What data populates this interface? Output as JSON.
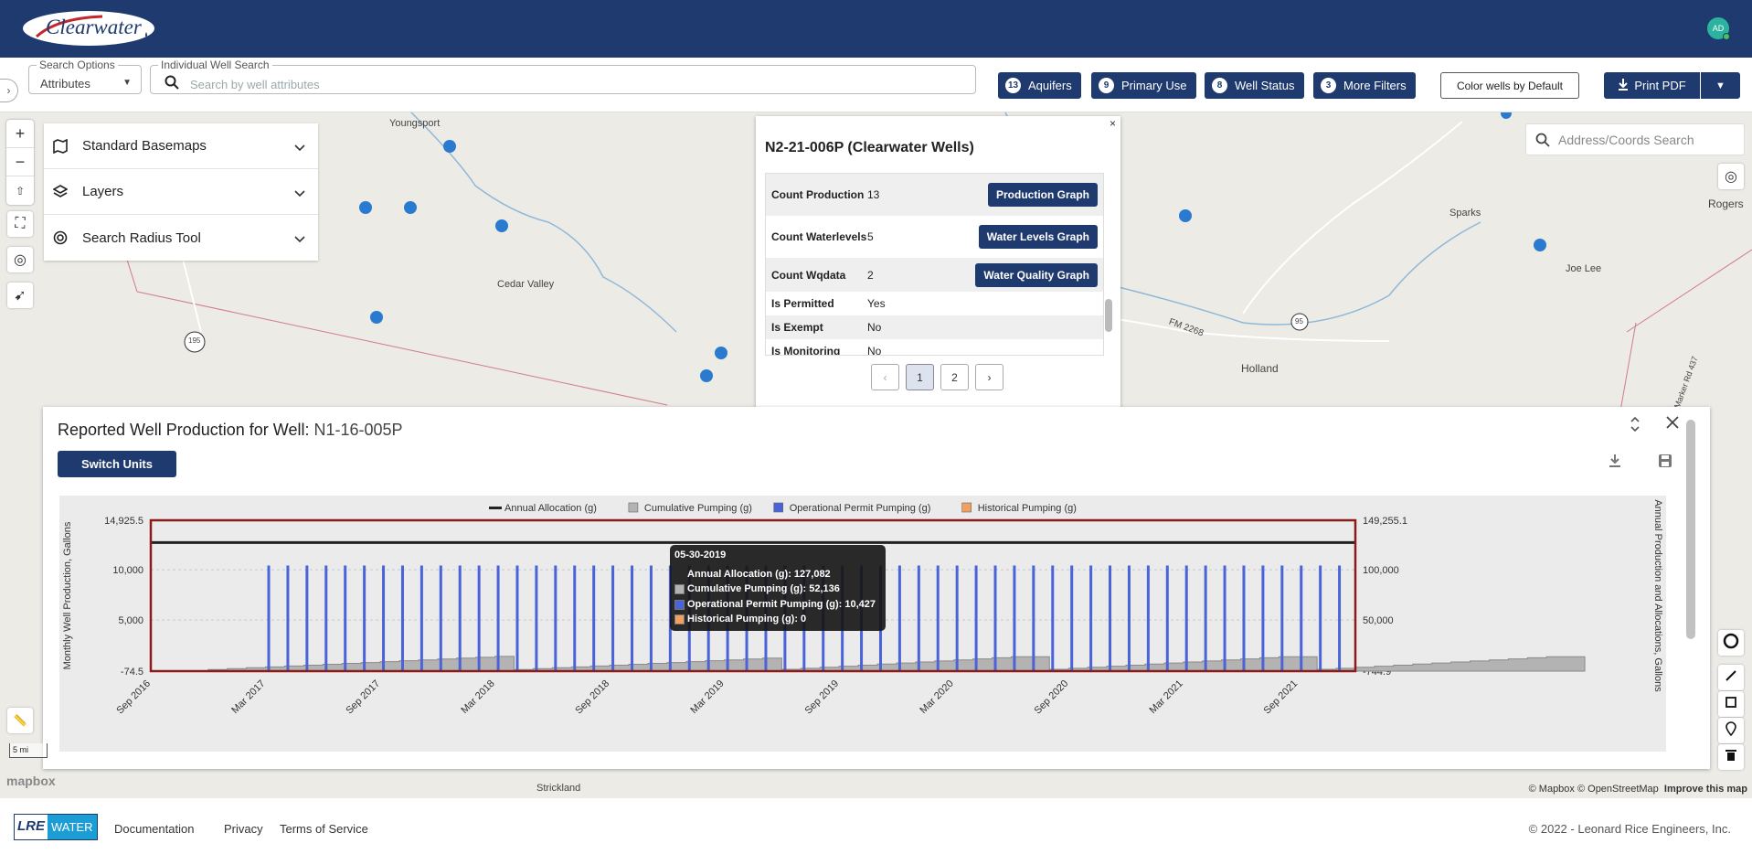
{
  "header": {
    "brand": "Clearwater",
    "avatar_initials": "AD",
    "bg_color": "#1f3a6e"
  },
  "toolbar": {
    "search_options_label": "Search Options",
    "search_options_value": "Attributes",
    "well_search_label": "Individual Well Search",
    "well_search_placeholder": "Search by well attributes",
    "filters": [
      {
        "count": "13",
        "label": "Aquifers"
      },
      {
        "count": "9",
        "label": "Primary Use"
      },
      {
        "count": "8",
        "label": "Well Status"
      },
      {
        "count": "3",
        "label": "More Filters"
      }
    ],
    "color_by": "Color wells by Default",
    "print_label": "Print PDF"
  },
  "map": {
    "layer_panel": [
      "Standard Basemaps",
      "Layers",
      "Search Radius Tool"
    ],
    "address_placeholder": "Address/Coords Search",
    "labels": {
      "youngsport": "Youngsport",
      "cedar_valley": "Cedar Valley",
      "sparks": "Sparks",
      "rogers": "Rogers",
      "joe_lee": "Joe Lee",
      "fm2268": "FM 2268",
      "holland": "Holland",
      "strickland": "Strickland",
      "r195": "195",
      "r95": "95",
      "rd437": "Marker Rd 437"
    },
    "scale": "5 mi",
    "mapbox_logo": "mapbox",
    "attribution": "© Mapbox © OpenStreetMap",
    "improve": "Improve this map",
    "well_color": "#2a7ad0"
  },
  "popup": {
    "title": "N2-21-006P (Clearwater Wells)",
    "rows": [
      {
        "key": "Count Production",
        "value": "13",
        "button": "Production Graph"
      },
      {
        "key": "Count Waterlevels",
        "value": "5",
        "button": "Water Levels Graph"
      },
      {
        "key": "Count Wqdata",
        "value": "2",
        "button": "Water Quality Graph"
      },
      {
        "key": "Is Permitted",
        "value": "Yes",
        "button": ""
      },
      {
        "key": "Is Exempt",
        "value": "No",
        "button": ""
      },
      {
        "key": "Is Monitoring",
        "value": "No",
        "button": ""
      }
    ],
    "pages": [
      "1",
      "2"
    ],
    "current_page": "1"
  },
  "chart_panel": {
    "title_prefix": "Reported Well Production for Well:",
    "well_id": "N1-16-005P",
    "switch_units": "Switch Units"
  },
  "chart_data": {
    "type": "bar",
    "legend": [
      {
        "name": "Annual Allocation (g)",
        "color": "#222222"
      },
      {
        "name": "Cumulative Pumping (g)",
        "color": "#b3b3b3"
      },
      {
        "name": "Operational Permit Pumping (g)",
        "color": "#4a63d8"
      },
      {
        "name": "Historical Pumping (g)",
        "color": "#f0a060"
      }
    ],
    "ylabel_left": "Monthly Well Production, Gallons",
    "ylabel_right": "Annual Production and Allocations, Gallons",
    "left_ticks": [
      "14,925.5",
      "10,000",
      "5,000",
      "-74.5"
    ],
    "right_ticks": [
      "149,255.1",
      "100,000",
      "50,000",
      "-744.9"
    ],
    "ylim_left": [
      -74.5,
      14925.5
    ],
    "ylim_right": [
      -744.9,
      149255.1
    ],
    "x_ticks": [
      "Sep 2016",
      "Mar 2017",
      "Sep 2017",
      "Mar 2018",
      "Sep 2018",
      "Mar 2019",
      "Sep 2019",
      "Mar 2020",
      "Sep 2020",
      "Mar 2021",
      "Sep 2021"
    ],
    "annual_allocation": 127082,
    "operational_monthly": 10427,
    "cumulative_years": [
      {
        "start": "2016-12",
        "monthly": [
          870,
          1740,
          2610,
          3480,
          4350,
          5220,
          6090,
          6960,
          7830,
          8700,
          9570,
          10440,
          11310,
          12180,
          13050,
          13920
        ]
      },
      {
        "start": "2018-04",
        "monthly": [
          870,
          1740,
          2610,
          3480,
          4350,
          5220,
          6090,
          6960,
          7830,
          8700,
          9570,
          10440,
          11310,
          12180
        ]
      },
      {
        "start": "2019-06",
        "monthly": [
          1043,
          2085,
          3128,
          4171,
          5214,
          6256,
          7299,
          8342,
          9384,
          10427,
          11470,
          12512,
          13555,
          13555
        ]
      },
      {
        "start": "2020-08",
        "monthly": [
          1043,
          2085,
          3128,
          4171,
          5214,
          6256,
          7299,
          8342,
          9384,
          10427,
          11470,
          12512,
          13555,
          13555
        ]
      },
      {
        "start": "2021-10",
        "monthly": [
          1043,
          2085,
          3128,
          4171,
          5214,
          6256,
          7299,
          8342,
          9384,
          10427,
          11470,
          12512,
          13555,
          13555
        ]
      }
    ],
    "tooltip": {
      "date": "05-30-2019",
      "lines": [
        {
          "label": "Annual Allocation (g): 127,082",
          "color": ""
        },
        {
          "label": "Cumulative Pumping (g): 52,136",
          "color": "#b3b3b3"
        },
        {
          "label": "Operational Permit Pumping (g): 10,427",
          "color": "#4a63d8"
        },
        {
          "label": "Historical Pumping (g): 0",
          "color": "#f0a060"
        }
      ]
    }
  },
  "footer": {
    "brand_left": "LRE",
    "brand_right": "WATER",
    "links": [
      "Documentation",
      "Privacy",
      "Terms of Service"
    ],
    "copyright": "© 2022 - Leonard Rice Engineers, Inc."
  }
}
